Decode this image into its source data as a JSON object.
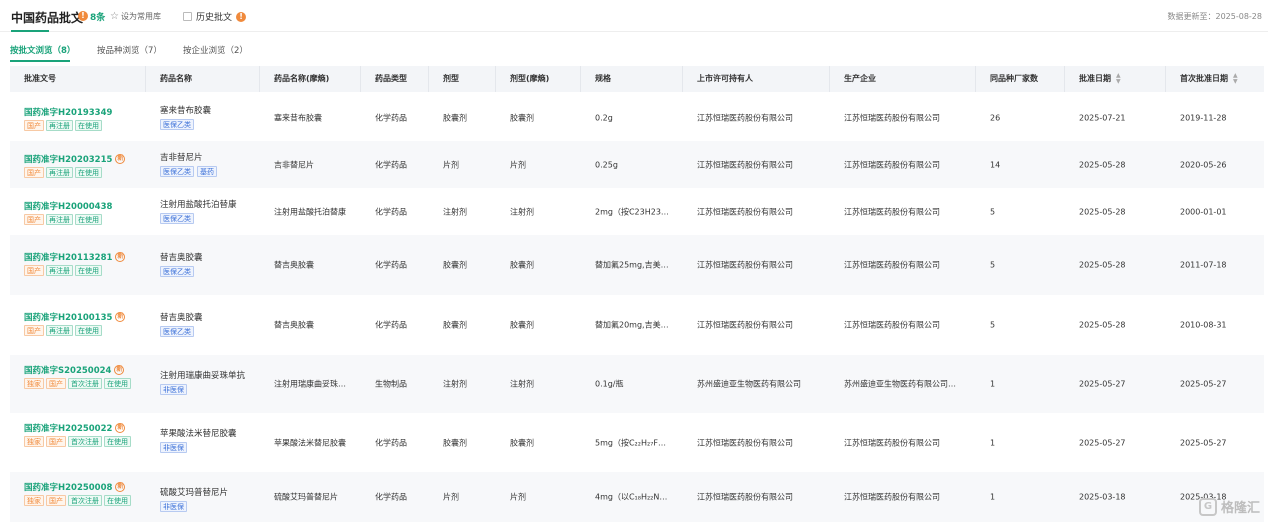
{
  "header": {
    "title": "中国药品批文",
    "count": "8条",
    "favorite_label": "设为常用库",
    "history_label": "历史批文",
    "update_text": "数据更新至：2025-08-28"
  },
  "tabs": [
    {
      "label": "按批文浏览（8）"
    },
    {
      "label": "按品种浏览（7）"
    },
    {
      "label": "按企业浏览（2）"
    }
  ],
  "columns": [
    "批准文号",
    "药品名称",
    "药品名称(摩熵)",
    "药品类型",
    "剂型",
    "剂型(摩熵)",
    "规格",
    "上市许可持有人",
    "生产企业",
    "同品种厂家数",
    "批准日期",
    "首次批准日期"
  ],
  "rows": [
    {
      "approval": "国药准字H20193349",
      "mark": "",
      "tags": [
        "国产",
        "再注册",
        "在使用"
      ],
      "drug": "塞来昔布胶囊",
      "drug_tags": [
        "医保乙类"
      ],
      "name_moshang": "塞来昔布胶囊",
      "type": "化学药品",
      "form": "胶囊剂",
      "form_moshang": "胶囊剂",
      "spec": "0.2g",
      "holder": "江苏恒瑞医药股份有限公司",
      "maker": "江苏恒瑞医药股份有限公司",
      "makers_count": "26",
      "date": "2025-07-21",
      "first_date": "2019-11-28"
    },
    {
      "approval": "国药准字H20203215",
      "mark": "⑱",
      "tags": [
        "国产",
        "再注册",
        "在使用"
      ],
      "drug": "吉非替尼片",
      "drug_tags": [
        "医保乙类",
        "基药"
      ],
      "name_moshang": "吉非替尼片",
      "type": "化学药品",
      "form": "片剂",
      "form_moshang": "片剂",
      "spec": "0.25g",
      "holder": "江苏恒瑞医药股份有限公司",
      "maker": "江苏恒瑞医药股份有限公司",
      "makers_count": "14",
      "date": "2025-05-28",
      "first_date": "2020-05-26"
    },
    {
      "approval": "国药准字H20000438",
      "mark": "",
      "tags": [
        "国产",
        "再注册",
        "在使用"
      ],
      "drug": "注射用盐酸托泊替康",
      "drug_tags": [
        "医保乙类"
      ],
      "name_moshang": "注射用盐酸托泊替康",
      "type": "化学药品",
      "form": "注射剂",
      "form_moshang": "注射剂",
      "spec": "2mg（按C23H23…",
      "holder": "江苏恒瑞医药股份有限公司",
      "maker": "江苏恒瑞医药股份有限公司",
      "makers_count": "5",
      "date": "2025-05-28",
      "first_date": "2000-01-01"
    },
    {
      "approval": "国药准字H20113281",
      "mark": "⑱",
      "tags": [
        "国产",
        "再注册",
        "在使用"
      ],
      "drug": "替吉奥胶囊",
      "drug_tags": [
        "医保乙类"
      ],
      "name_moshang": "替吉奥胶囊",
      "type": "化学药品",
      "form": "胶囊剂",
      "form_moshang": "胶囊剂",
      "spec": "替加氟25mg,吉美…",
      "holder": "江苏恒瑞医药股份有限公司",
      "maker": "江苏恒瑞医药股份有限公司",
      "makers_count": "5",
      "date": "2025-05-28",
      "first_date": "2011-07-18"
    },
    {
      "approval": "国药准字H20100135",
      "mark": "⑱",
      "tags": [
        "国产",
        "再注册",
        "在使用"
      ],
      "drug": "替吉奥胶囊",
      "drug_tags": [
        "医保乙类"
      ],
      "name_moshang": "替吉奥胶囊",
      "type": "化学药品",
      "form": "胶囊剂",
      "form_moshang": "胶囊剂",
      "spec": "替加氟20mg,吉美…",
      "holder": "江苏恒瑞医药股份有限公司",
      "maker": "江苏恒瑞医药股份有限公司",
      "makers_count": "5",
      "date": "2025-05-28",
      "first_date": "2010-08-31"
    },
    {
      "approval": "国药准字S20250024",
      "mark": "⑱",
      "tags": [
        "独家",
        "国产",
        "首次注册",
        "在使用"
      ],
      "drug": "注射用瑞康曲妥珠单抗",
      "drug_tags": [
        "非医保"
      ],
      "name_moshang": "注射用瑞康曲妥珠…",
      "type": "生物制品",
      "form": "注射剂",
      "form_moshang": "注射剂",
      "spec": "0.1g/瓶",
      "holder": "苏州盛迪亚生物医药有限公司",
      "maker": "苏州盛迪亚生物医药有限公司…",
      "makers_count": "1",
      "date": "2025-05-27",
      "first_date": "2025-05-27"
    },
    {
      "approval": "国药准字H20250022",
      "mark": "⑱",
      "tags": [
        "独家",
        "国产",
        "首次注册",
        "在使用"
      ],
      "drug": "苹果酸法米替尼胶囊",
      "drug_tags": [
        "非医保"
      ],
      "name_moshang": "苹果酸法米替尼胶囊",
      "type": "化学药品",
      "form": "胶囊剂",
      "form_moshang": "胶囊剂",
      "spec": "5mg（按C₂₂H₂₇F…",
      "holder": "江苏恒瑞医药股份有限公司",
      "maker": "江苏恒瑞医药股份有限公司",
      "makers_count": "1",
      "date": "2025-05-27",
      "first_date": "2025-05-27"
    },
    {
      "approval": "国药准字H20250008",
      "mark": "⑱",
      "tags": [
        "独家",
        "国产",
        "首次注册",
        "在使用"
      ],
      "drug": "硫酸艾玛普替尼片",
      "drug_tags": [
        "非医保"
      ],
      "name_moshang": "硫酸艾玛普替尼片",
      "type": "化学药品",
      "form": "片剂",
      "form_moshang": "片剂",
      "spec": "4mg（以C₁₈H₂₂N…",
      "holder": "江苏恒瑞医药股份有限公司",
      "maker": "江苏恒瑞医药股份有限公司",
      "makers_count": "1",
      "date": "2025-03-18",
      "first_date": "2025-03-18"
    }
  ],
  "watermark": "格隆汇",
  "colors": {
    "accent": "#1aa37a",
    "orange": "#f08a3c",
    "blue": "#3a6fd8"
  }
}
